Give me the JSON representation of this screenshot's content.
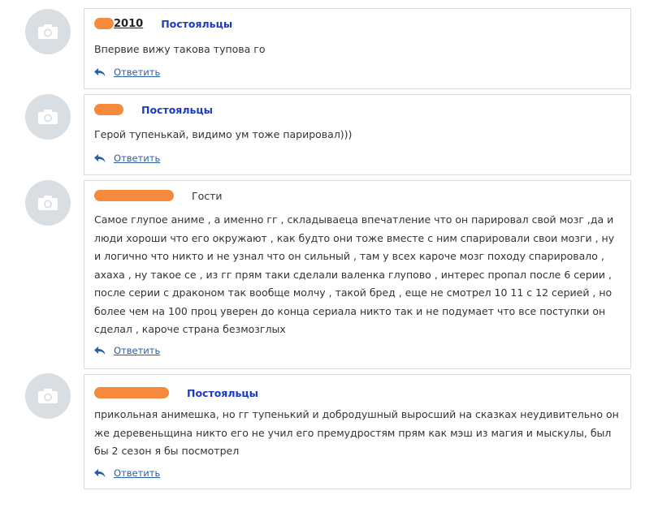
{
  "comments": [
    {
      "author": "2010",
      "group": "Постояльцы",
      "text": "Впервие вижу такова тупова го",
      "reply_label": "Ответить"
    },
    {
      "author": "",
      "group": "Постояльцы",
      "text": "Герой тупенькай, видимо ум тоже парировал)))",
      "reply_label": "Ответить"
    },
    {
      "author": "",
      "group": "Гости",
      "text": "Самое глупое аниме , а именно гг , складываеца впечатление что он парировал свой мозг ,да и люди хороши что его окружают , как будто они тоже вместе с ним спарировали свои мозги , ну и логично что никто и не узнал что он сильный , там у всех кароче мозг походу спарировало , ахаха , ну такое се , из гг прям таки сделали валенка глупово , интерес пропал после 6 серии , после серии с драконом так вообще молчу , такой бред , еще не смотрел 10 11 с 12 серией , но более чем на 100 проц уверен до конца сериала никто так и не подумает что все поступки он сделал , кароче страна безмозглых",
      "reply_label": "Ответить"
    },
    {
      "author": "",
      "group": "Постояльцы",
      "text": "прикольная анимешка, но гг тупенький и добродушный выросший на сказках неудивительно он же деревеньщина никто его не учил его премудростям прям как мэш из магия и мыскулы, был бы 2 сезон я бы посмотрел",
      "reply_label": "Ответить"
    }
  ],
  "colors": {
    "group_link": "#1a3cc4",
    "reply_link": "#2a5fa3",
    "redaction": "#f58a3c"
  },
  "icons": {
    "avatar": "camera-icon",
    "reply": "reply-arrow-icon"
  }
}
